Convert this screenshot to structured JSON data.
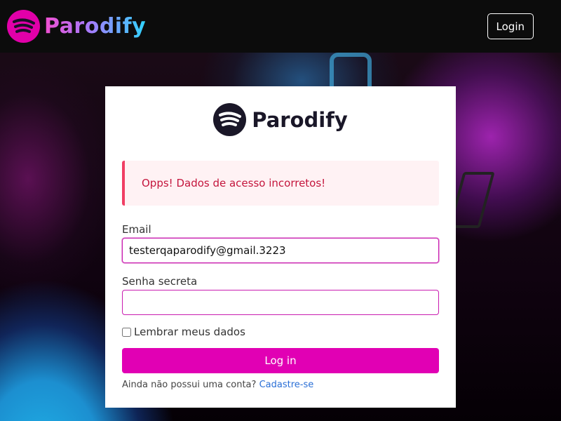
{
  "brand": {
    "name": "Parodify"
  },
  "nav": {
    "login_label": "Login"
  },
  "card": {
    "brand_name": "Parodify",
    "alert": "Opps! Dados de acesso incorretos!",
    "email_label": "Email",
    "email_value": "testerqaparodify@gmail.3223",
    "password_label": "Senha secreta",
    "password_value": "",
    "remember_label": "Lembrar meus dados",
    "remember_checked": false,
    "submit_label": "Log in",
    "signup_prompt": "Ainda não possui uma conta?",
    "signup_link": "Cadastre-se"
  },
  "colors": {
    "accent": "#e100b4",
    "alert_text": "#c4163d",
    "alert_bg": "#fff2f4",
    "link": "#2a6fd6",
    "navbar_bg": "#0c0c0c"
  },
  "icons": {
    "brand_logo": "soundwave-logo-icon"
  }
}
